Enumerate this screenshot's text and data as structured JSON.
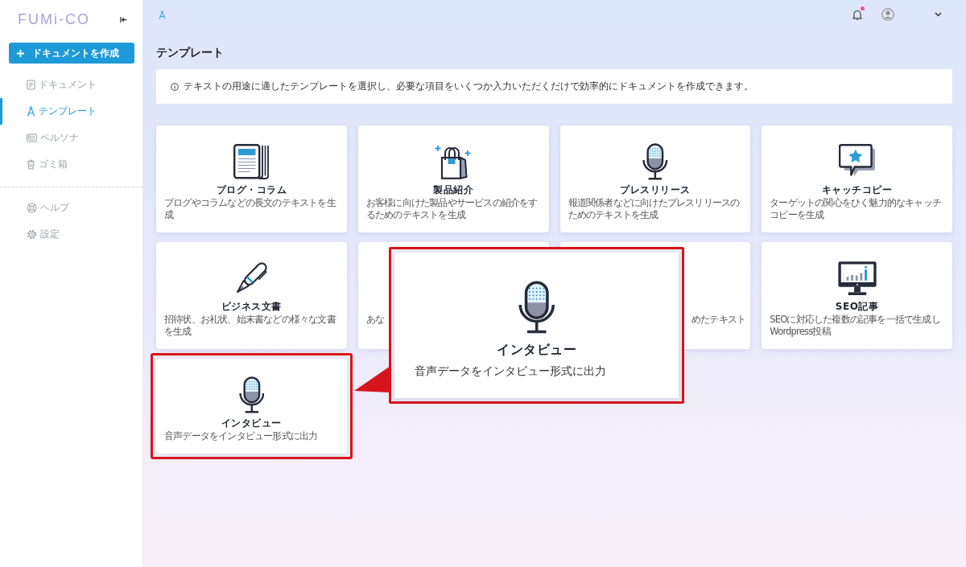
{
  "sidebar": {
    "logo": "FUMi-CO",
    "create_button": "ドキュメントを作成",
    "nav": [
      {
        "label": "ドキュメント",
        "selected": false
      },
      {
        "label": "テンプレート",
        "selected": true
      },
      {
        "label": "ペルソナ",
        "selected": false
      },
      {
        "label": "ゴミ箱",
        "selected": false
      }
    ],
    "nav_secondary": [
      {
        "label": "ヘルプ",
        "selected": false
      },
      {
        "label": "設定",
        "selected": false
      }
    ]
  },
  "header": {
    "notifications": {
      "unread": true
    }
  },
  "page": {
    "title": "テンプレート",
    "info": "テキストの用途に適したテンプレートを選択し、必要な項目をいくつか入力いただくだけで効率的にドキュメントを作成できます。"
  },
  "templates": [
    {
      "kind": "full",
      "title": "ブログ・コラム",
      "description": "ブログやコラムなどの長文のテキストを生成",
      "highlighted": false
    },
    {
      "kind": "full",
      "title": "製品紹介",
      "description": "お客様に向けた製品やサービスの紹介をするためのテキストを生成",
      "highlighted": false
    },
    {
      "kind": "full",
      "title": "プレスリリース",
      "description": "報道関係者などに向けたプレスリリースのためのテキストを生成",
      "highlighted": false
    },
    {
      "kind": "full",
      "title": "キャッチコピー",
      "description": "ターゲットの関心をひく魅力的なキャッチコピーを生成",
      "highlighted": false
    },
    {
      "kind": "full",
      "title": "ビジネス文書",
      "description": "招待状、お礼状、始末書などの様々な文書を生成",
      "highlighted": false
    },
    {
      "kind": "head",
      "description": "あな",
      "highlighted": false
    },
    {
      "kind": "tail",
      "description": "めたテキスト",
      "highlighted": false
    },
    {
      "kind": "full",
      "title": "SEO記事",
      "description": "SEOに対応した複数の記事を一括で生成しWordpress投稿",
      "highlighted": false
    },
    {
      "kind": "full",
      "title": "インタビュー",
      "description": "音声データをインタビュー形式に出力",
      "highlighted": true
    }
  ],
  "callout": {
    "title": "インタビュー",
    "description": "音声データをインタビュー形式に出力"
  }
}
